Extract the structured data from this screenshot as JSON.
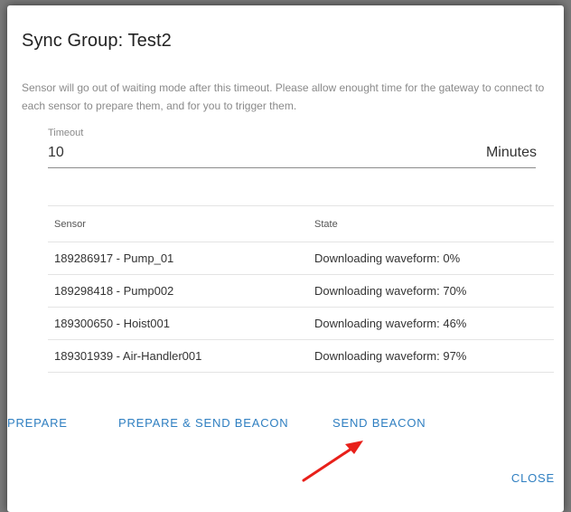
{
  "dialog": {
    "title": "Sync Group: Test2",
    "description": "Sensor will go out of waiting mode after this timeout. Please allow enought time for the gateway to connect to each sensor to prepare them, and for you to trigger them.",
    "timeout": {
      "label": "Timeout",
      "value": "10",
      "unit": "Minutes"
    },
    "table": {
      "headers": [
        "Sensor",
        "State"
      ],
      "rows": [
        {
          "sensor": "189286917 - Pump_01",
          "state": "Downloading waveform: 0%"
        },
        {
          "sensor": "189298418 - Pump002",
          "state": "Downloading waveform: 70%"
        },
        {
          "sensor": "189300650 - Hoist001",
          "state": "Downloading waveform: 46%"
        },
        {
          "sensor": "189301939 - Air-Handler001",
          "state": "Downloading waveform: 97%"
        }
      ]
    },
    "actions": {
      "prepare": "PREPARE",
      "prepare_send_beacon": "PREPARE & SEND BEACON",
      "send_beacon": "SEND BEACON",
      "close": "CLOSE"
    }
  },
  "colors": {
    "accent": "#2f7fc1",
    "annotation_arrow": "#e8201a"
  },
  "icons": {
    "annotation": "red-arrow-icon"
  }
}
